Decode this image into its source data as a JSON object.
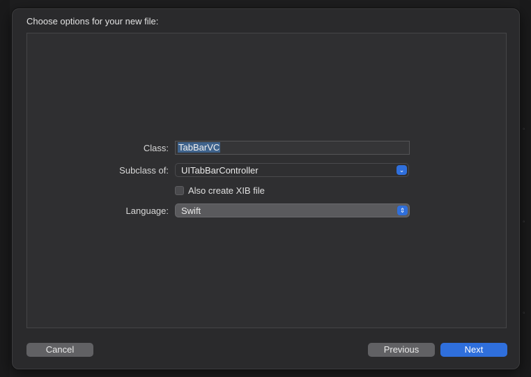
{
  "dialog": {
    "title": "Choose options for your new file:",
    "class": {
      "label": "Class:",
      "value": "TabBarVC"
    },
    "subclass": {
      "label": "Subclass of:",
      "value": "UITabBarController"
    },
    "xib": {
      "label": "Also create XIB file",
      "checked": false
    },
    "language": {
      "label": "Language:",
      "value": "Swift"
    },
    "buttons": {
      "cancel": "Cancel",
      "previous": "Previous",
      "next": "Next"
    }
  },
  "colors": {
    "accent": "#2f6fdc",
    "selection": "#3f638c",
    "sheet": "#2a2a2c"
  }
}
